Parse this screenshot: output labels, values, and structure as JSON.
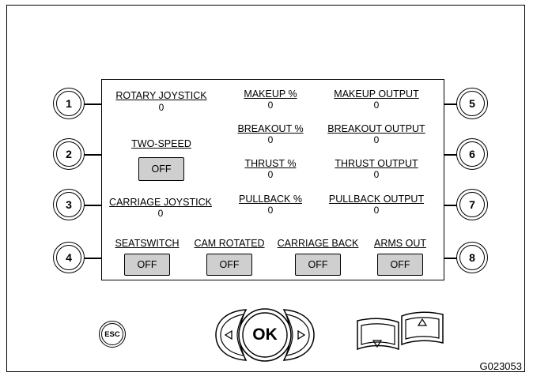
{
  "side_buttons": {
    "b1": "1",
    "b2": "2",
    "b3": "3",
    "b4": "4",
    "b5": "5",
    "b6": "6",
    "b7": "7",
    "b8": "8"
  },
  "screen": {
    "rotary_joystick": {
      "label": "ROTARY JOYSTICK",
      "value": "0"
    },
    "two_speed": {
      "label": "TWO-SPEED",
      "state": "OFF"
    },
    "carriage_joystick": {
      "label": "CARRIAGE JOYSTICK",
      "value": "0"
    },
    "makeup_pct": {
      "label": "MAKEUP %",
      "value": "0"
    },
    "breakout_pct": {
      "label": "BREAKOUT %",
      "value": "0"
    },
    "thrust_pct": {
      "label": "THRUST %",
      "value": "0"
    },
    "pullback_pct": {
      "label": "PULLBACK %",
      "value": "0"
    },
    "makeup_output": {
      "label": "MAKEUP OUTPUT",
      "value": "0"
    },
    "breakout_output": {
      "label": "BREAKOUT OUTPUT",
      "value": "0"
    },
    "thrust_output": {
      "label": "THRUST OUTPUT",
      "value": "0"
    },
    "pullback_output": {
      "label": "PULLBACK OUTPUT",
      "value": "0"
    },
    "seatswitch": {
      "label": "SEATSWITCH",
      "state": "OFF"
    },
    "cam_rotated": {
      "label": "CAM ROTATED",
      "state": "OFF"
    },
    "carriage_back": {
      "label": "CARRIAGE BACK",
      "state": "OFF"
    },
    "arms_out": {
      "label": "ARMS OUT",
      "state": "OFF"
    }
  },
  "keypad": {
    "esc_label": "ESC",
    "ok_label": "OK",
    "left_icon": "triangle-left-icon",
    "right_icon": "triangle-right-icon",
    "up_icon": "triangle-up-icon",
    "down_icon": "triangle-down-icon"
  },
  "figure_code": "G023053"
}
